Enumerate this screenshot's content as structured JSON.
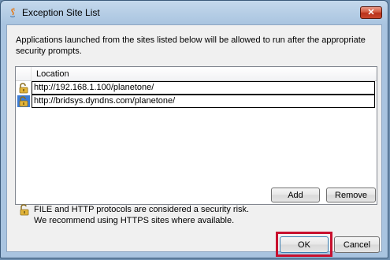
{
  "window": {
    "title": "Exception Site List",
    "app_icon": "java-icon",
    "close_symbol": "✕"
  },
  "description": "Applications launched from the sites listed below will be allowed to run after the appropriate security prompts.",
  "list": {
    "column_header": "Location",
    "rows": [
      {
        "url": "http://192.168.1.100/planetone/",
        "icon": "lock-icon",
        "selected": false
      },
      {
        "url": "http://bridsys.dyndns.com/planetone/",
        "icon": "lock-icon",
        "selected": true
      }
    ]
  },
  "buttons": {
    "add": "Add",
    "remove": "Remove",
    "ok": "OK",
    "cancel": "Cancel"
  },
  "warning": {
    "line1": "FILE and HTTP protocols are considered a security risk.",
    "line2": "We recommend using HTTPS sites where available."
  },
  "colors": {
    "title_bar": "#a9c4e0",
    "close_button": "#c9472e",
    "selection": "#3a7bd5",
    "highlight_box": "#c8102e"
  }
}
